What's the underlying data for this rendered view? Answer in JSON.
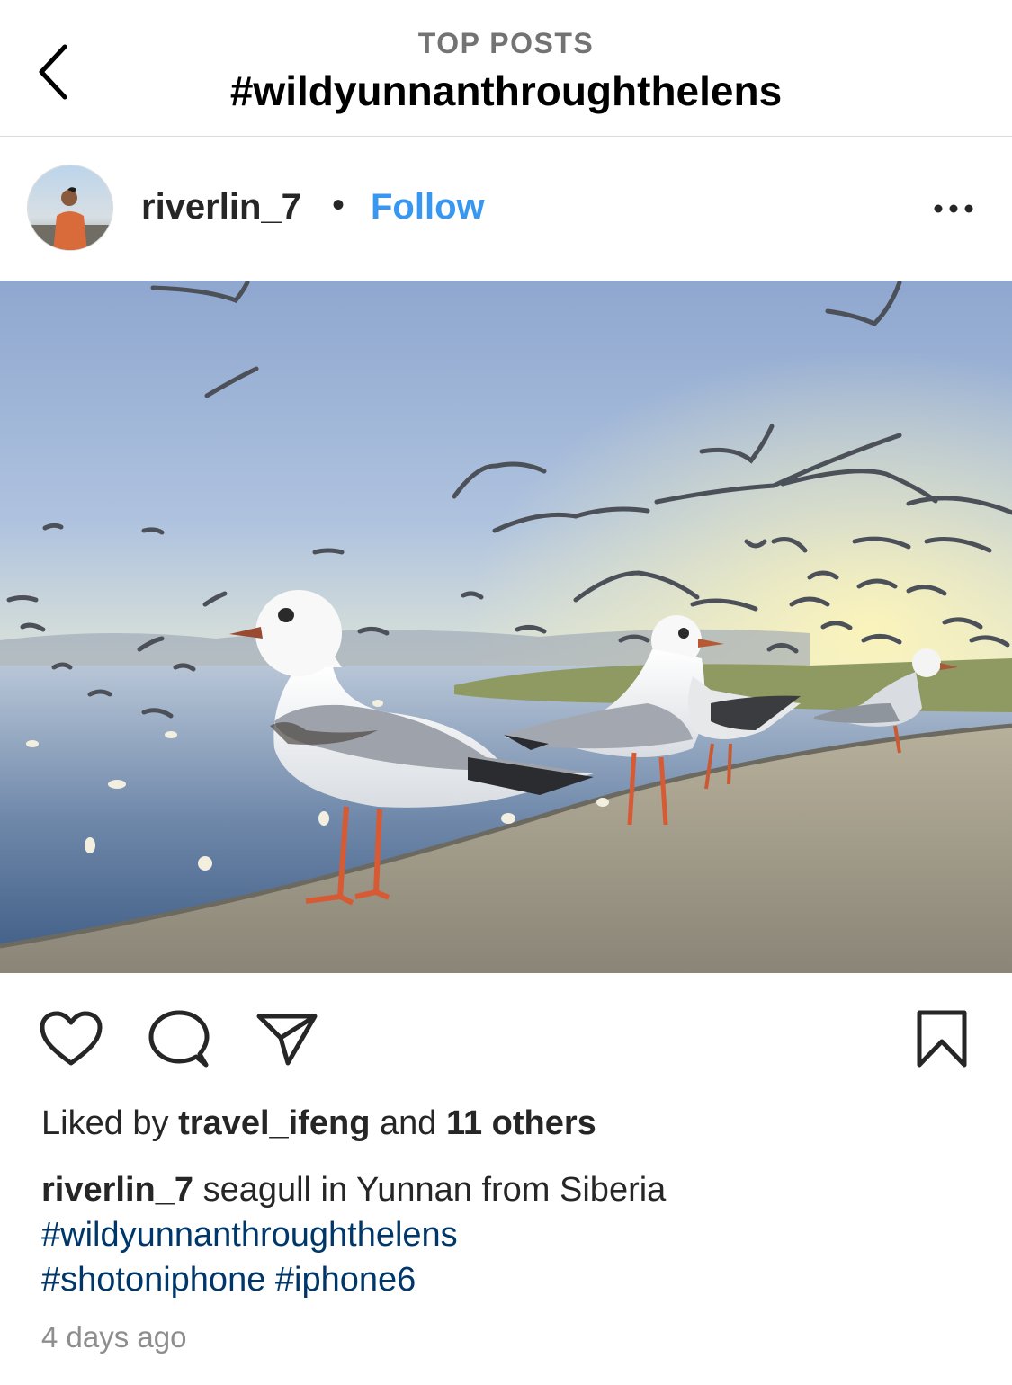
{
  "header": {
    "subtitle": "TOP POSTS",
    "title": "#wildyunnanthroughthelens"
  },
  "post": {
    "username": "riverlin_7",
    "separator": "•",
    "follow_label": "Follow",
    "likes": {
      "prefix": "Liked by",
      "user": "travel_ifeng",
      "middle": "and",
      "others": "11 others"
    },
    "caption": {
      "user": "riverlin_7",
      "text": "seagull in Yunnan from Siberia",
      "tags": [
        "#wildyunnanthroughthelens",
        "#shotoniphone",
        "#iphone6"
      ]
    },
    "timestamp": "4 days ago"
  },
  "icons": {
    "back": "chevron-left-icon",
    "more": "more-horizontal-icon",
    "like": "heart-icon",
    "comment": "comment-icon",
    "share": "send-icon",
    "save": "bookmark-icon"
  },
  "colors": {
    "link_blue": "#3897f0",
    "hashtag": "#00376b",
    "muted": "#8e8e8e"
  }
}
